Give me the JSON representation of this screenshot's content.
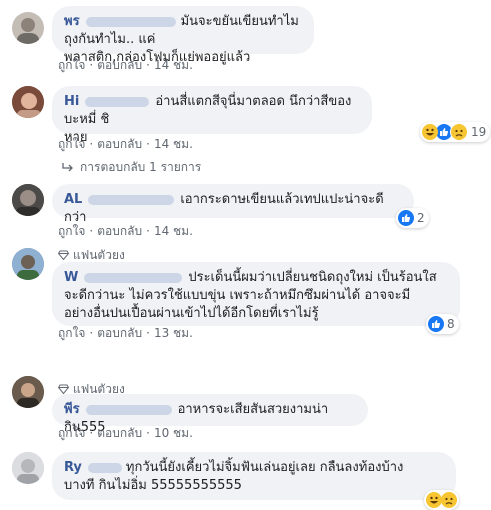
{
  "comments": [
    {
      "name": "พร",
      "text_lines": [
        "มันจะขยันเขียนทำไมถุงกันทำไม.. แค่",
        "พลาสติก,กล่องโฟมก็แย่พออยู่แล้ว"
      ],
      "like": "ถูกใจ",
      "reply": "ตอบกลับ",
      "time": "14 ชม."
    },
    {
      "name": "Hi",
      "text_lines": [
        "อ่านสี่แตกสีจุนี่มาตลอด นึกว่าสีของบะหมี่ ชิ",
        "หาย"
      ],
      "like": "ถูกใจ",
      "reply": "ตอบกลับ",
      "time": "14 ชม.",
      "reaction_count": "19",
      "replies_label": "การตอบกลับ 1 รายการ"
    },
    {
      "name": "AL",
      "text_lines": [
        "เอากระดาษเขียนแล้วเทปแปะน่าจะดีกว่า"
      ],
      "like": "ถูกใจ",
      "reply": "ตอบกลับ",
      "time": "14 ชม.",
      "reaction_count": "2"
    },
    {
      "badge": "แฟนตัวยง",
      "name": "W",
      "text_lines": [
        "ประเด็นนี้ผมว่าเปลี่ยนชนิดถุงใหม่ เป็นร้อนใส",
        "จะดีกว่านะ ไม่ควรใช้แบบขุ่น เพราะถ้าหมึกซึมผ่านได้ อาจจะมี",
        "อย่างอื่นปนเปื้อนผ่านเข้าไปได้อีกโดยที่เราไม่รู้"
      ],
      "like": "ถูกใจ",
      "reply": "ตอบกลับ",
      "time": "13 ชม.",
      "reaction_count": "8"
    },
    {
      "badge": "แฟนตัวยง",
      "name": "พีร",
      "text_lines": [
        "อาหารจะเสียสันสวยงามน่ากิน555"
      ],
      "like": "ถูกใจ",
      "reply": "ตอบกลับ",
      "time": "10 ชม."
    },
    {
      "name": "Ry",
      "text_lines": [
        "ทุกวันนี้ยังเคี้ยวไม่จิ้มฟันเล่นอยู่เลย กลืนลงท้องบ้าง",
        "บางที กินไม่อิ่ม 55555555555"
      ],
      "like": "",
      "reply": "",
      "time": ""
    }
  ],
  "colors": {
    "bubble": "#f0f2f5",
    "name": "#385898",
    "meta": "#606770",
    "like_blue": "#1877f2",
    "haha_yellow": "#f7c531"
  },
  "icons": [
    "diamond-icon",
    "reply-arrow-icon",
    "like-reaction-icon",
    "haha-reaction-icon",
    "sad-reaction-icon"
  ]
}
